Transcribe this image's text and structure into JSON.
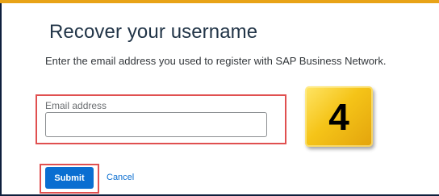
{
  "page": {
    "title": "Recover your username",
    "subtitle": "Enter the email address you used to register with SAP Business Network."
  },
  "form": {
    "email_label": "Email address",
    "email_value": "",
    "submit_label": "Submit",
    "cancel_label": "Cancel"
  },
  "annotation": {
    "step_number": "4"
  },
  "colors": {
    "accent_blue": "#0a6ed1",
    "highlight_red": "#e05050",
    "badge_yellow": "#f5c418",
    "frame_navy": "#0e1f3d"
  }
}
